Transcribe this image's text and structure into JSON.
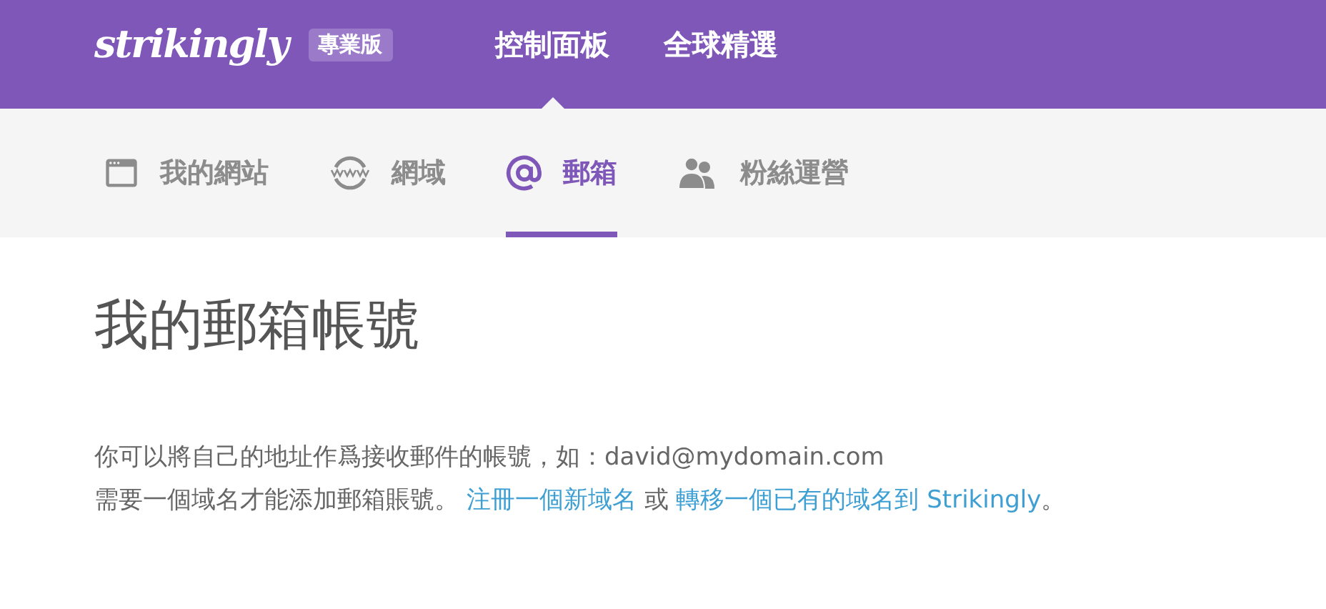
{
  "header": {
    "logo": "strikingly",
    "badge": "專業版",
    "nav": [
      {
        "label": "控制面板",
        "selected": true
      },
      {
        "label": "全球精選",
        "selected": false
      }
    ]
  },
  "tabs": [
    {
      "kind": "site",
      "label": "我的網站",
      "selected": false
    },
    {
      "kind": "domain",
      "label": "網域",
      "selected": false
    },
    {
      "kind": "email",
      "label": "郵箱",
      "selected": true
    },
    {
      "kind": "fans",
      "label": "粉絲運營",
      "selected": false
    }
  ],
  "title": "我的郵箱帳號",
  "intro": "你可以將自己的地址作爲接收郵件的帳號，如：david@mydomain.com",
  "note": [
    {
      "kind": "text",
      "text": "需要一個域名才能添加郵箱賬號。 "
    },
    {
      "kind": "link",
      "text": "注冊一個新域名"
    },
    {
      "kind": "text",
      "text": " 或 "
    },
    {
      "kind": "link",
      "text": "轉移一個已有的域名到 Strikingly"
    },
    {
      "kind": "text",
      "text": "。"
    }
  ]
}
